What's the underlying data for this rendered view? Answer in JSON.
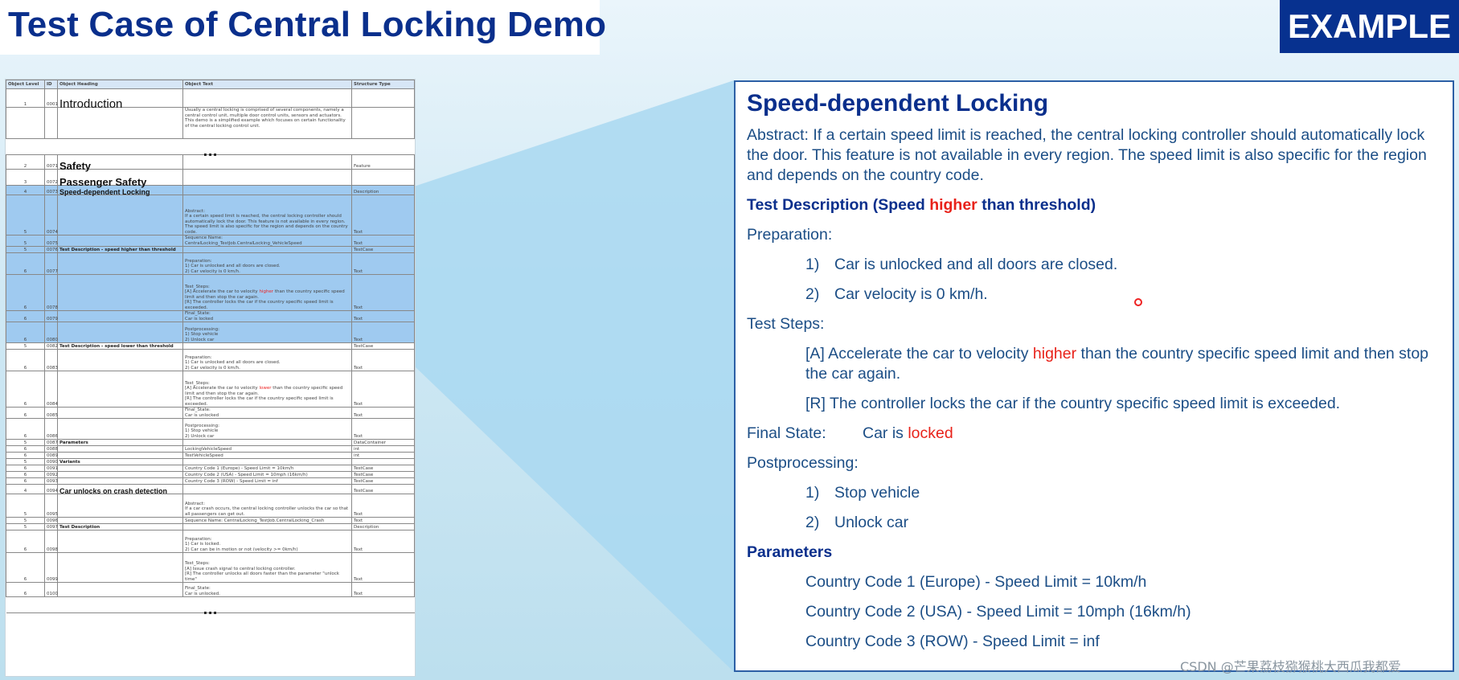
{
  "page_title": "Test Case of Central Locking Demo",
  "badge": "EXAMPLE",
  "watermark": "CSDN @芒果荔枝猕猴桃大西瓜我都爱",
  "sheet": {
    "headers": [
      "Object Level",
      "ID",
      "Object Heading",
      "Object Text",
      "Structure Type"
    ],
    "ellipsis": "...",
    "rows": {
      "r1": {
        "level": "1",
        "id": "0001",
        "heading": "Introduction",
        "text": "",
        "type": ""
      },
      "r2": {
        "level": "",
        "id": "",
        "heading": "",
        "text": "Usually a central locking is comprised of several components, namely a central control unit, multiple door control units, sensors and actuators. This demo is a simplified example which focuses on certain functionality of the central locking control unit.",
        "type": ""
      },
      "r3": {
        "level": "2",
        "id": "0071",
        "heading": "Safety",
        "text": "",
        "type": "Feature"
      },
      "r4": {
        "level": "3",
        "id": "0072",
        "heading": "Passenger Safety",
        "text": "",
        "type": ""
      },
      "r5": {
        "level": "4",
        "id": "0073",
        "heading": "Speed-dependent Locking",
        "text": "",
        "type": "Description"
      },
      "r6": {
        "level": "5",
        "id": "0074",
        "heading": "",
        "text": "Abstract:\nIf a certain speed limit is reached, the central locking controller should automatically lock the door. This feature is not available in every region. The speed limit is also specific for the region and depends on the country code.",
        "type": "Text"
      },
      "r7": {
        "level": "5",
        "id": "0075",
        "heading": "",
        "text": "Sequence Name:\nCentralLocking_TestJob.CentralLocking_VehicleSpeed",
        "type": "Text"
      },
      "r8": {
        "level": "5",
        "id": "0076",
        "heading": "Test Description - speed higher than threshold",
        "text": "",
        "type": "TestCase"
      },
      "r9": {
        "level": "6",
        "id": "0077",
        "heading": "",
        "text": "Preparation:\n1) Car is unlocked and all doors are closed.\n2) Car velocity is 0 km/h.",
        "type": "Text"
      },
      "r10": {
        "level": "6",
        "id": "0078",
        "heading": "",
        "text_a": "Test_Steps:\n[A] Accelerate the car to velocity ",
        "text_red": "higher",
        "text_b": " than the country specific speed limit and then stop the car again.\n[R] The controller locks the car if the country specific speed limit is exceeded.",
        "type": "Text"
      },
      "r11": {
        "level": "6",
        "id": "0079",
        "heading": "",
        "text": "Final_State:\nCar is locked",
        "type": "Text"
      },
      "r12": {
        "level": "6",
        "id": "0080",
        "heading": "",
        "text": "Postprocessing:\n1) Stop vehicle\n2) Unlock car",
        "type": "Text"
      },
      "r13": {
        "level": "5",
        "id": "0082",
        "heading": "Test Description - speed lower than threshold",
        "text": "",
        "type": "TestCase"
      },
      "r14": {
        "level": "6",
        "id": "0083",
        "heading": "",
        "text": "Preparation:\n1) Car is unlocked and all doors are closed.\n2) Car velocity is 0 km/h.",
        "type": "Text"
      },
      "r15": {
        "level": "6",
        "id": "0084",
        "heading": "",
        "text_a": "Test_Steps:\n[A] Accelerate the car to velocity ",
        "text_red": "lower",
        "text_b": " than the country specific speed limit and then stop the car again.\n[R] The controller locks the car if the country specific speed limit is exceeded.",
        "type": "Text"
      },
      "r16": {
        "level": "6",
        "id": "0085",
        "heading": "",
        "text": "Final_State:\nCar is unlocked",
        "type": "Text"
      },
      "r17": {
        "level": "6",
        "id": "0086",
        "heading": "",
        "text": "Postprocessing:\n1) Stop vehicle\n2) Unlock car",
        "type": "Text"
      },
      "r18": {
        "level": "5",
        "id": "0087",
        "heading": "Parameters",
        "text": "",
        "type": "DataContainer"
      },
      "r19": {
        "level": "6",
        "id": "0088",
        "heading": "",
        "text": "LockingVehicleSpeed",
        "type": "int"
      },
      "r20": {
        "level": "6",
        "id": "0089",
        "heading": "",
        "text": "TestVehicleSpeed",
        "type": "int"
      },
      "r21": {
        "level": "5",
        "id": "0090",
        "heading": "Variants",
        "text": "",
        "type": ""
      },
      "r22": {
        "level": "6",
        "id": "0091",
        "heading": "",
        "text": "Country Code 1 (Europe) - Speed Limit = 10km/h",
        "type": "TestCase"
      },
      "r23": {
        "level": "6",
        "id": "0092",
        "heading": "",
        "text": "Country Code 2 (USA) - Speed Limit = 10mph (16km/h)",
        "type": "TestCase"
      },
      "r24": {
        "level": "6",
        "id": "0093",
        "heading": "",
        "text": "Country Code 3 (ROW) - Speed Limit = inf",
        "type": "TestCase"
      },
      "r25": {
        "level": "4",
        "id": "0094",
        "heading": "Car unlocks on crash detection",
        "text": "",
        "type": "TestCase"
      },
      "r26": {
        "level": "5",
        "id": "0095",
        "heading": "",
        "text": "Abstract:\nIf a car crash occurs, the central locking controller unlocks the car so that all passengers can get out.",
        "type": "Text"
      },
      "r27": {
        "level": "5",
        "id": "0096",
        "heading": "",
        "text": "Sequence Name: CentralLocking_TestJob.CentralLocking_Crash",
        "type": "Text"
      },
      "r28": {
        "level": "5",
        "id": "0097",
        "heading": "Test Description",
        "text": "",
        "type": "Description"
      },
      "r29": {
        "level": "6",
        "id": "0098",
        "heading": "",
        "text": "Preparation:\n1) Car is locked.\n2) Car can be in motion or not (velocity >= 0km/h)",
        "type": "Text"
      },
      "r30": {
        "level": "6",
        "id": "0099",
        "heading": "",
        "text": "Test_Steps:\n[A] Issue crash signal to central locking controller.\n[R] The controller unlocks all doors faster than the parameter \"unlock time\"",
        "type": "Text"
      },
      "r31": {
        "level": "6",
        "id": "0100",
        "heading": "",
        "text": "Final_State:\nCar is unlocked.",
        "type": "Text"
      }
    }
  },
  "panel": {
    "title": "Speed-dependent Locking",
    "abstract": "Abstract: If a certain speed limit is reached, the central locking controller should automatically lock the door. This feature is not available in every region. The speed limit is also specific for the region and depends on the country code.",
    "test_desc_prefix": "Test Description (Speed ",
    "test_desc_highlight": "higher",
    "test_desc_suffix": " than threshold)",
    "preparation_label": "Preparation:",
    "prep_1_num": "1)",
    "prep_1": "Car is unlocked and all doors are closed.",
    "prep_2_num": "2)",
    "prep_2": "Car velocity is 0 km/h.",
    "steps_label": "Test Steps:",
    "step_a_prefix": "[A] Accelerate the car to velocity ",
    "step_a_highlight": "higher",
    "step_a_suffix": " than the country specific speed limit and then stop the car again.",
    "step_r": "[R] The controller locks the car if the country specific speed limit is exceeded.",
    "final_label": "Final State:",
    "final_prefix": "Car is ",
    "final_highlight": "locked",
    "post_label": "Postprocessing:",
    "post_1_num": "1)",
    "post_1": "Stop vehicle",
    "post_2_num": "2)",
    "post_2": "Unlock car",
    "params_label": "Parameters",
    "param_1": "Country Code 1 (Europe) - Speed Limit = 10km/h",
    "param_2": "Country Code 2 (USA) - Speed Limit = 10mph (16km/h)",
    "param_3": "Country Code 3 (ROW) - Speed Limit = inf"
  },
  "colors": {
    "title": "#0a2f8c",
    "badge_bg": "#07318f",
    "highlight_row": "#9fcaf0",
    "accent_red": "#e8221a"
  }
}
